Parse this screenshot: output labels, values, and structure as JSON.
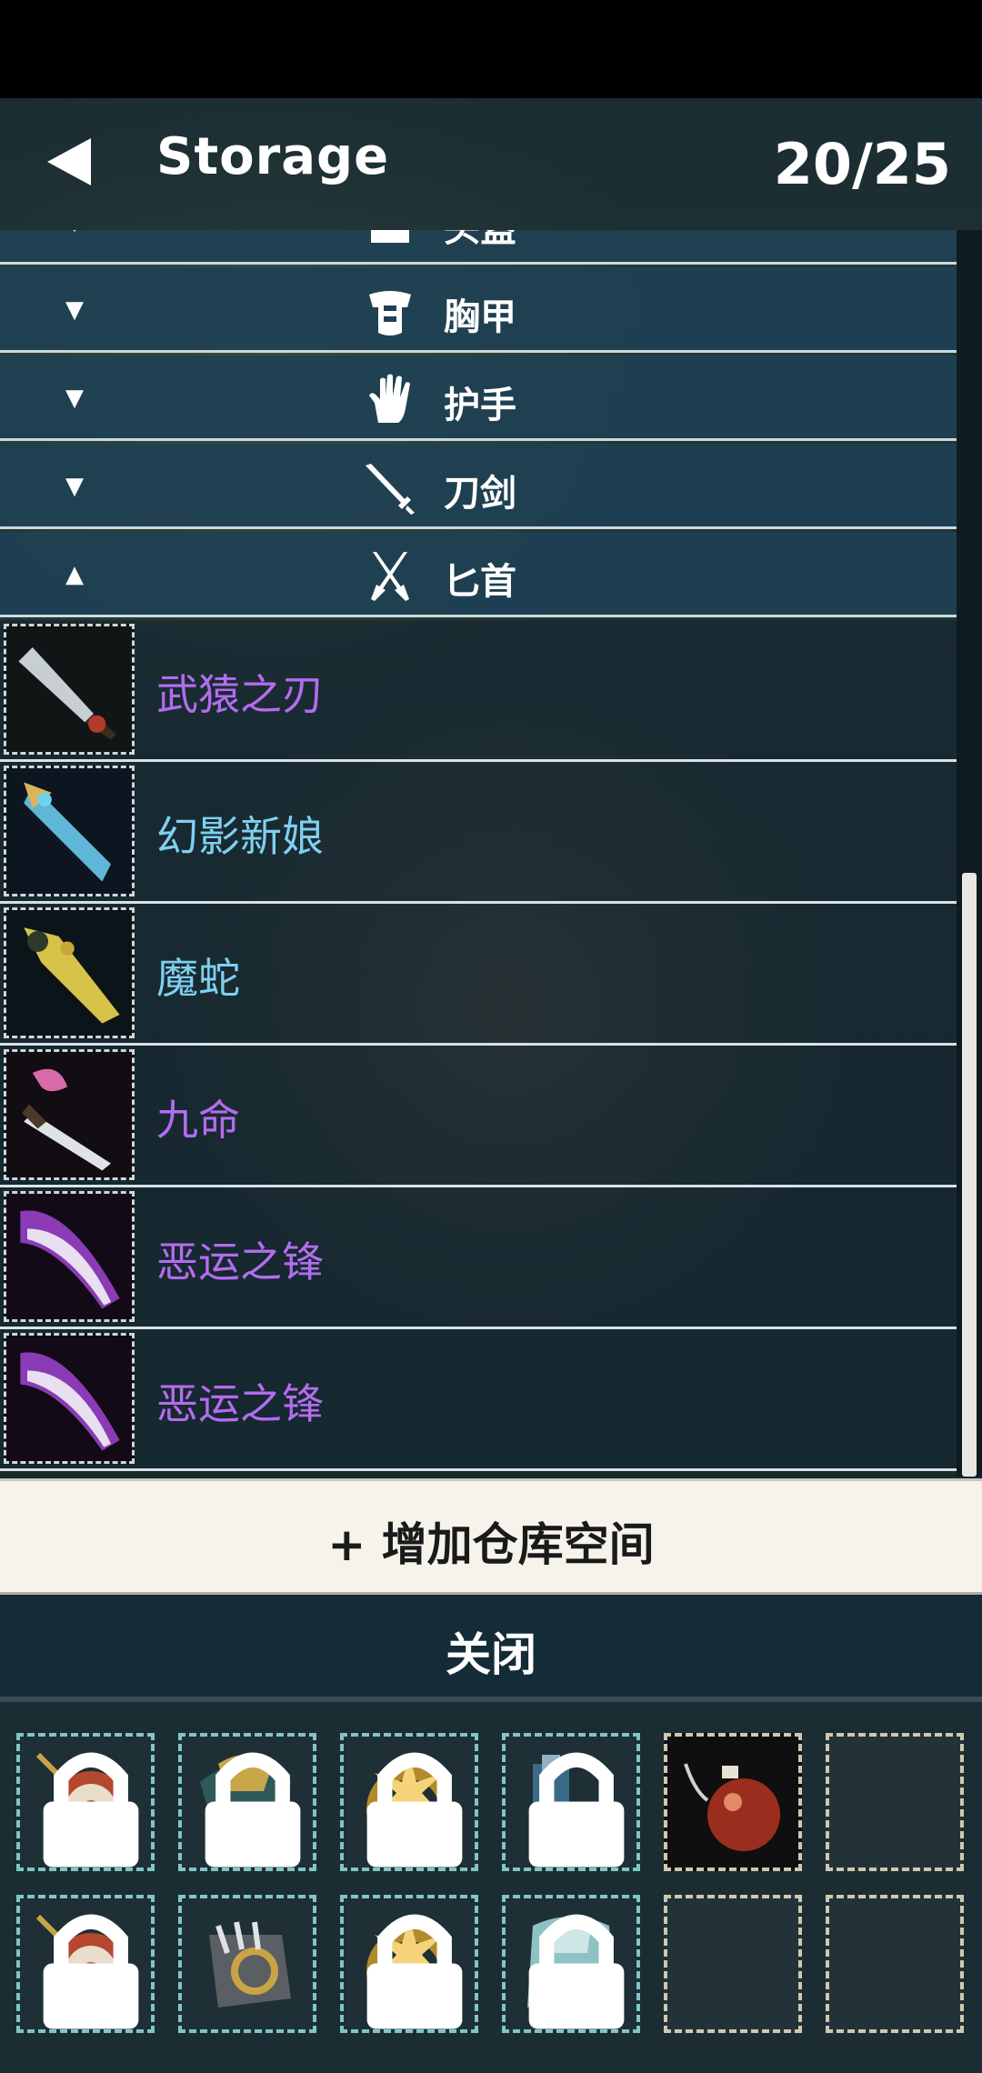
{
  "header": {
    "title": "Storage",
    "count": "20/25"
  },
  "categories": [
    {
      "label": "头盔",
      "arrow": "▼",
      "icon": "helmet-icon"
    },
    {
      "label": "胸甲",
      "arrow": "▼",
      "icon": "chest-armor-icon"
    },
    {
      "label": "护手",
      "arrow": "▼",
      "icon": "gauntlet-icon"
    },
    {
      "label": "刀剑",
      "arrow": "▼",
      "icon": "sword-icon"
    },
    {
      "label": "匕首",
      "arrow": "▲",
      "icon": "crossed-daggers-icon"
    }
  ],
  "items": [
    {
      "name": "武猿之刃",
      "color": "#b46cf0"
    },
    {
      "name": "幻影新娘",
      "color": "#7fd0f0"
    },
    {
      "name": "魔蛇",
      "color": "#7fd0f0"
    },
    {
      "name": "九命",
      "color": "#b46cf0"
    },
    {
      "name": "恶运之锋",
      "color": "#b46cf0"
    },
    {
      "name": "恶运之锋",
      "color": "#b46cf0"
    }
  ],
  "actions": {
    "expand_label": "+ 增加仓库空间",
    "close_label": "关闭"
  },
  "colors": {
    "epic_purple": "#b46cf0",
    "rare_blue": "#7fd0f0",
    "category_bg": "#1e4155",
    "button_light": "#f6f4ea"
  }
}
